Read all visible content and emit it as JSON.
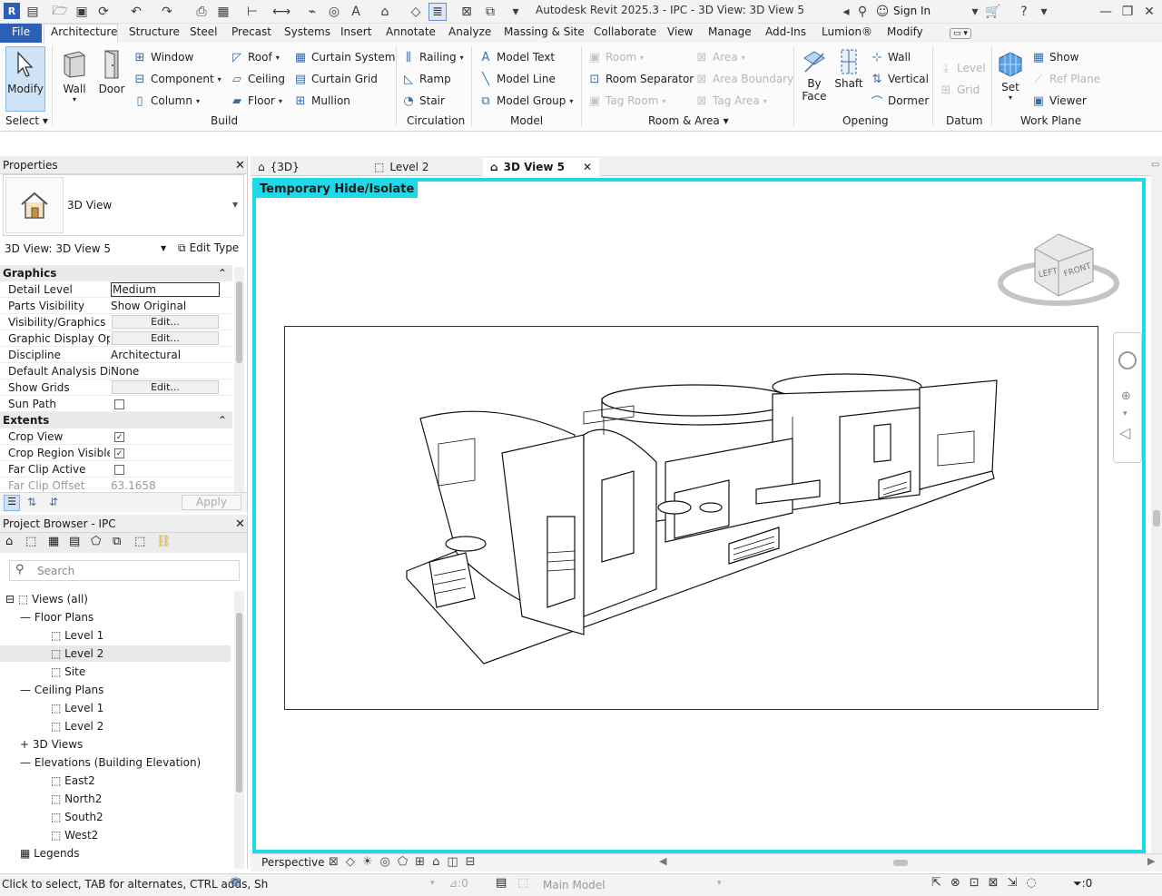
{
  "app": {
    "title": "Autodesk Revit 2025.3 - IPC - 3D View: 3D View 5",
    "sign_in": "Sign In"
  },
  "ribbon_tabs": [
    "File",
    "Architecture",
    "Structure",
    "Steel",
    "Precast",
    "Systems",
    "Insert",
    "Annotate",
    "Analyze",
    "Massing & Site",
    "Collaborate",
    "View",
    "Manage",
    "Add-Ins",
    "Lumion®",
    "Modify"
  ],
  "ribbon": {
    "select": {
      "modify": "Modify",
      "label": "Select"
    },
    "build": {
      "wall": "Wall",
      "door": "Door",
      "window": "Window",
      "component": "Component",
      "column": "Column",
      "roof": "Roof",
      "ceiling": "Ceiling",
      "floor": "Floor",
      "curtain_system": "Curtain System",
      "curtain_grid": "Curtain Grid",
      "mullion": "Mullion",
      "label": "Build"
    },
    "circulation": {
      "railing": "Railing",
      "ramp": "Ramp",
      "stair": "Stair",
      "label": "Circulation"
    },
    "model": {
      "text": "Model Text",
      "line": "Model Line",
      "group": "Model Group",
      "label": "Model"
    },
    "room_area": {
      "room": "Room",
      "separator": "Room Separator",
      "tag_room": "Tag Room",
      "area": "Area",
      "area_boundary": "Area Boundary",
      "tag_area": "Tag Area",
      "label": "Room & Area"
    },
    "opening": {
      "by_face_1": "By",
      "by_face_2": "Face",
      "shaft": "Shaft",
      "wall": "Wall",
      "vertical": "Vertical",
      "dormer": "Dormer",
      "label": "Opening"
    },
    "datum": {
      "level": "Level",
      "grid": "Grid",
      "label": "Datum"
    },
    "work_plane": {
      "set": "Set",
      "show": "Show",
      "ref_plane": "Ref Plane",
      "viewer": "Viewer",
      "label": "Work Plane"
    }
  },
  "properties": {
    "title": "Properties",
    "type_name": "3D View",
    "instance": "3D View: 3D View 5",
    "edit_type": "Edit Type",
    "apply": "Apply",
    "groups": {
      "graphics": "Graphics",
      "extents": "Extents"
    },
    "rows": [
      {
        "k": "Detail Level",
        "v": "Medium"
      },
      {
        "k": "Parts Visibility",
        "v": "Show Original"
      },
      {
        "k": "Visibility/Graphics ...",
        "v": "Edit..."
      },
      {
        "k": "Graphic Display Op...",
        "v": "Edit..."
      },
      {
        "k": "Discipline",
        "v": "Architectural"
      },
      {
        "k": "Default Analysis Di...",
        "v": "None"
      },
      {
        "k": "Show Grids",
        "v": "Edit..."
      },
      {
        "k": "Sun Path",
        "v": ""
      },
      {
        "k": "Crop View",
        "v": ""
      },
      {
        "k": "Crop Region Visible",
        "v": ""
      },
      {
        "k": "Far Clip Active",
        "v": ""
      },
      {
        "k": "Far Clip Offset",
        "v": "63.1658"
      }
    ]
  },
  "browser": {
    "title": "Project Browser - IPC",
    "search_placeholder": "Search",
    "items": [
      "Views (all)",
      "Floor Plans",
      "Level 1",
      "Level 2",
      "Site",
      "Ceiling Plans",
      "Level 1",
      "Level 2",
      "3D Views",
      "Elevations (Building Elevation)",
      "East2",
      "North2",
      "South2",
      "West2",
      "Legends"
    ]
  },
  "view_tabs": [
    "{3D}",
    "Level 2",
    "3D View 5"
  ],
  "view": {
    "banner": "Temporary Hide/Isolate",
    "viewcube_left": "LEFT",
    "viewcube_front": "FRONT",
    "projection": "Perspective"
  },
  "status": {
    "hint": "Click to select, TAB for alternates, CTRL adds, Sh",
    "count1": ":0",
    "model": "Main Model",
    "count2": ":0"
  },
  "colors": {
    "accent": "#2b79d6",
    "hide_isolate": "#1fd8e8",
    "file_tab": "#2b5fb8"
  }
}
